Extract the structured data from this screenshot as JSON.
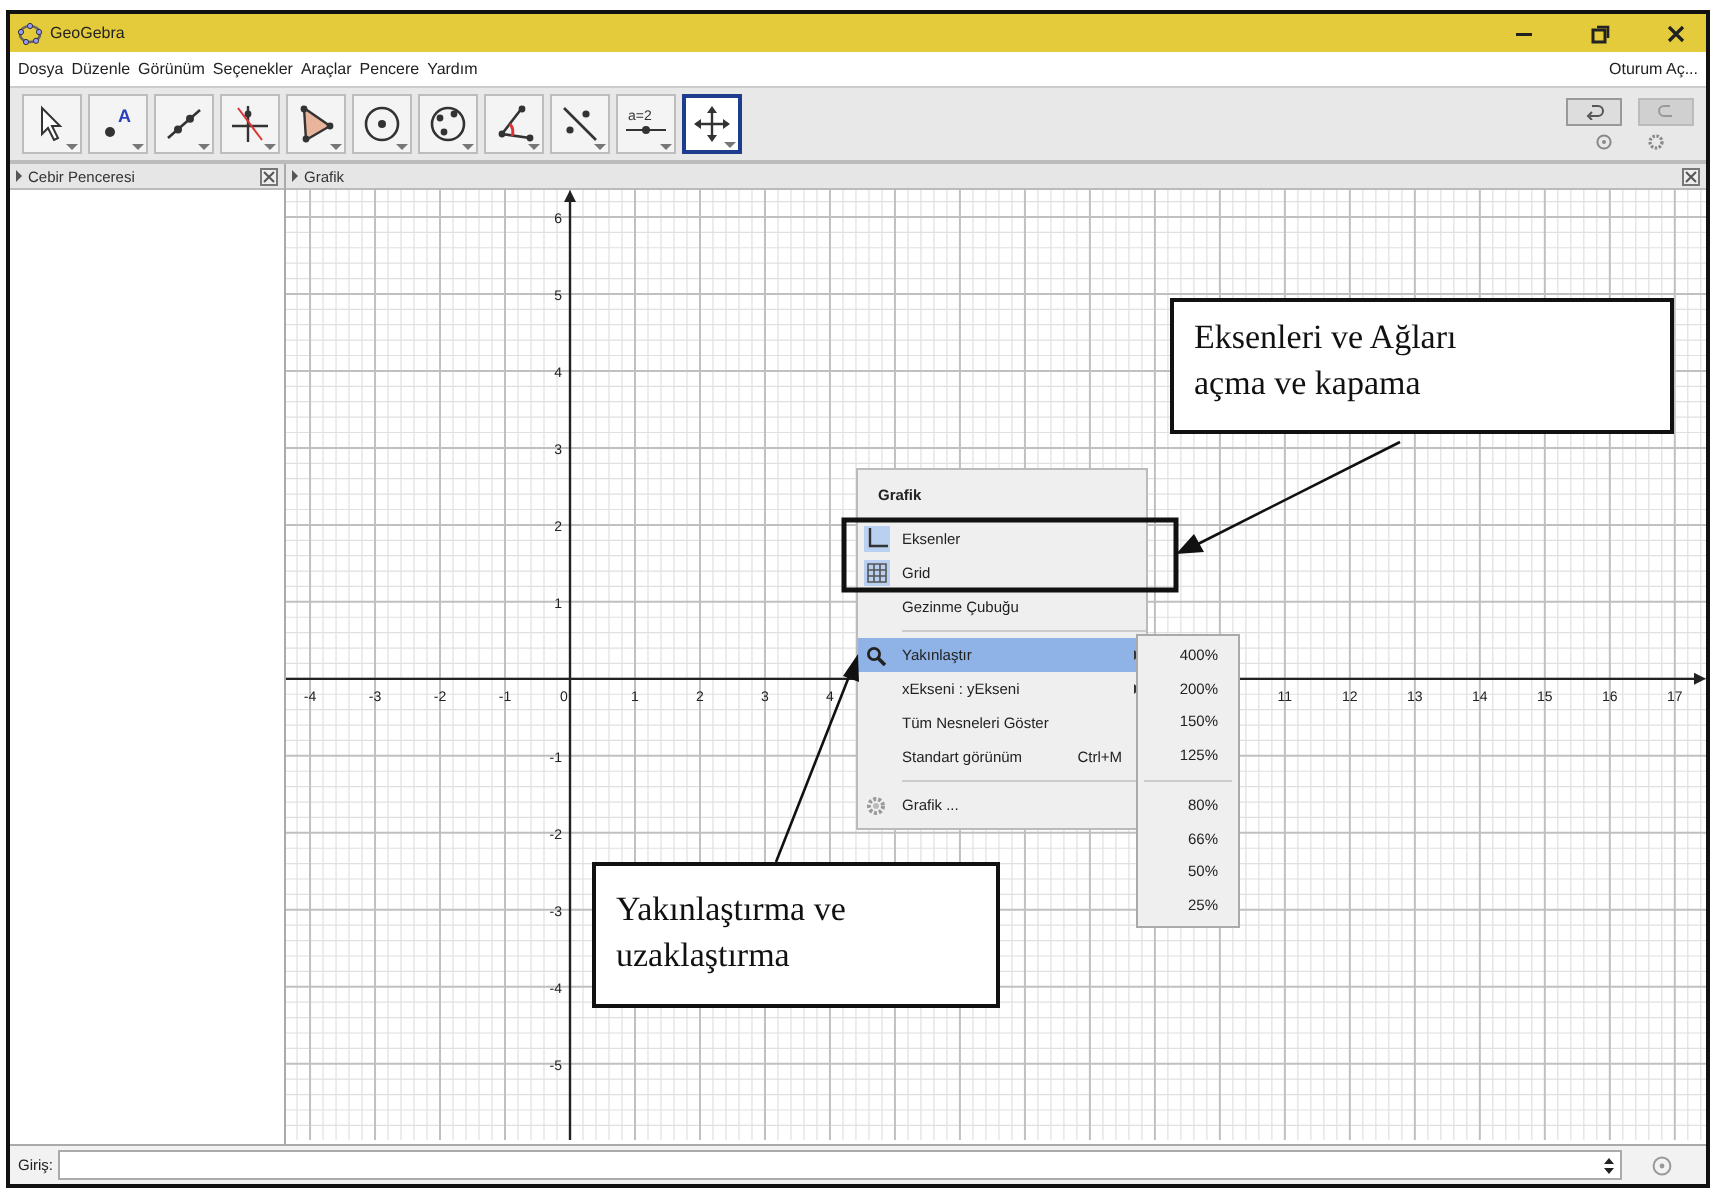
{
  "window": {
    "title": "GeoGebra"
  },
  "menu_bar": {
    "items": [
      "Dosya",
      "Düzenle",
      "Görünüm",
      "Seçenekler",
      "Araçlar",
      "Pencere",
      "Yardım"
    ],
    "sign_in": "Oturum Aç..."
  },
  "tools": [
    {
      "kind": "pointer",
      "selected": false
    },
    {
      "kind": "point",
      "label": "A",
      "selected": false
    },
    {
      "kind": "line",
      "selected": false
    },
    {
      "kind": "perpendicular",
      "selected": false
    },
    {
      "kind": "polygon",
      "selected": false
    },
    {
      "kind": "circle",
      "selected": false
    },
    {
      "kind": "conic",
      "selected": false
    },
    {
      "kind": "angle",
      "selected": false
    },
    {
      "kind": "reflect",
      "selected": false
    },
    {
      "kind": "slider",
      "label": "a=2",
      "selected": false
    },
    {
      "kind": "move",
      "selected": true
    }
  ],
  "algebra_panel": {
    "title": "Cebir Penceresi"
  },
  "graphics_panel": {
    "title": "Grafik",
    "chart_data": {
      "type": "line",
      "grid": true,
      "xlim": [
        -4.37,
        17.48
      ],
      "ylim": [
        -5.99,
        6.35
      ],
      "xticks": [
        -4,
        -3,
        -2,
        -1,
        0,
        1,
        2,
        3,
        4,
        11,
        12,
        13,
        14,
        15,
        16,
        17
      ],
      "yticks": [
        -5,
        -4,
        -3,
        -2,
        -1,
        1,
        2,
        3,
        4,
        5,
        6
      ]
    }
  },
  "context_menu": {
    "title": "Grafik",
    "items": [
      {
        "kind": "axes",
        "label": "Eksenler",
        "checked": true,
        "selected": false
      },
      {
        "kind": "grid",
        "label": "Grid",
        "checked": true,
        "selected": false
      },
      {
        "kind": "item",
        "label": "Gezinme Çubuğu",
        "selected": false
      },
      {
        "kind": "separator"
      },
      {
        "kind": "zoom",
        "label": "Yakınlaştır",
        "submenu": true,
        "selected": true
      },
      {
        "kind": "item",
        "label": "xEkseni : yEkseni",
        "submenu": true,
        "selected": false
      },
      {
        "kind": "item",
        "label": "Tüm Nesneleri Göster",
        "selected": false
      },
      {
        "kind": "item",
        "label": "Standart görünüm",
        "shortcut": "Ctrl+M",
        "selected": false
      },
      {
        "kind": "separator"
      },
      {
        "kind": "settings",
        "label": "Grafik ...",
        "selected": false
      }
    ]
  },
  "zoom_submenu": {
    "items": [
      {
        "kind": "item",
        "label": "400%"
      },
      {
        "kind": "item",
        "label": "200%"
      },
      {
        "kind": "item",
        "label": "150%"
      },
      {
        "kind": "item",
        "label": "125%"
      },
      {
        "kind": "separator"
      },
      {
        "kind": "item",
        "label": "80%"
      },
      {
        "kind": "item",
        "label": "66%"
      },
      {
        "kind": "item",
        "label": "50%"
      },
      {
        "kind": "item",
        "label": "25%"
      }
    ]
  },
  "annotations": [
    {
      "kind": "axes-grid",
      "text": "Eksenleri ve Ağları\naçma ve kapama"
    },
    {
      "kind": "zoom",
      "text": "Yakınlaştırma ve\nuzaklaştırma"
    }
  ],
  "input_bar": {
    "label": "Giriş:"
  }
}
